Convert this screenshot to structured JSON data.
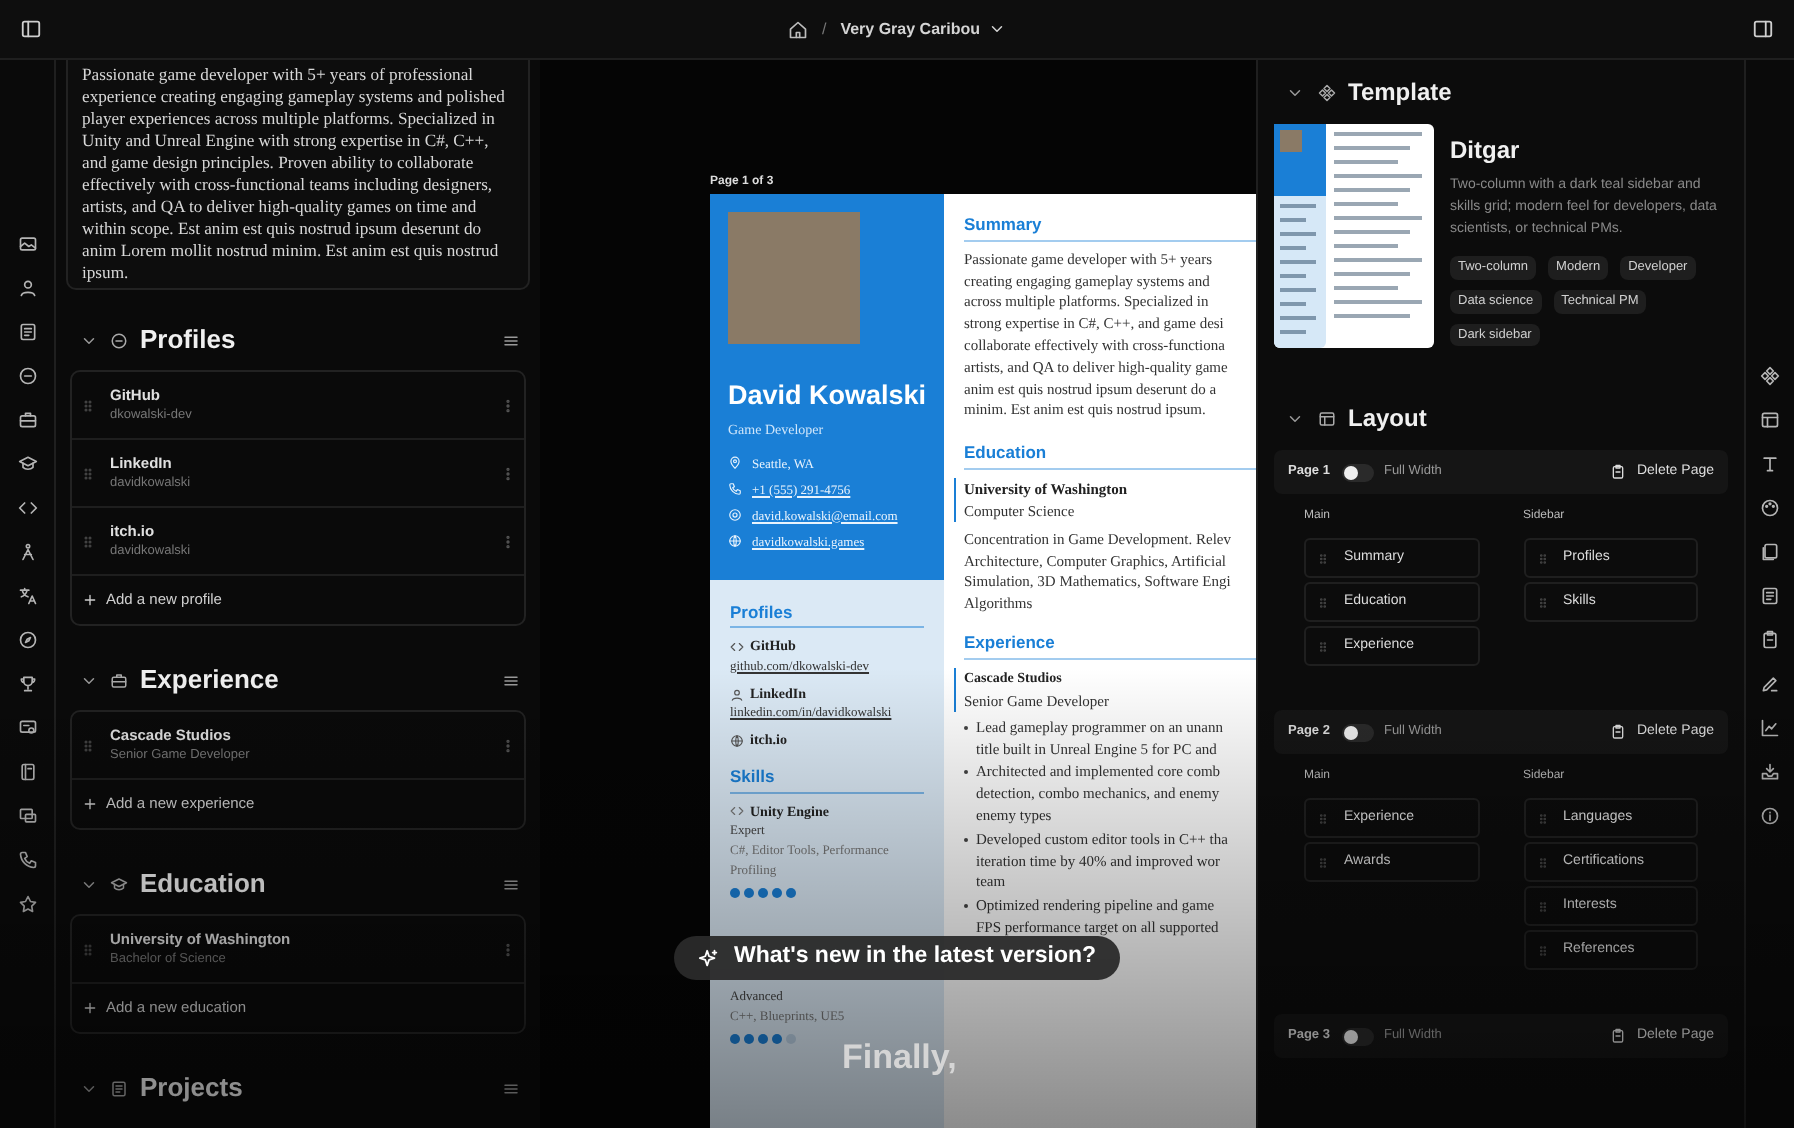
{
  "top_bar": {
    "separator": "/",
    "title": "Very Gray Caribou"
  },
  "left_panel": {
    "summary_text": "Passionate game developer with 5+ years of professional experience creating engaging gameplay systems and polished player experiences across multiple platforms. Specialized in Unity and Unreal Engine with strong expertise in C#, C++, and game design principles. Proven ability to collaborate effectively with cross-functional teams including designers, artists, and QA to deliver high-quality games on time and within scope. Est anim est quis nostrud ipsum deserunt do anim Lorem mollit nostrud minim. Est anim est quis nostrud ipsum.",
    "sections": [
      {
        "kind": "profiles",
        "title": "Profiles",
        "items": [
          {
            "title": "GitHub",
            "subtitle": "dkowalski-dev"
          },
          {
            "title": "LinkedIn",
            "subtitle": "davidkowalski"
          },
          {
            "title": "itch.io",
            "subtitle": "davidkowalski"
          }
        ],
        "add_label": "Add a new profile"
      },
      {
        "kind": "experience",
        "title": "Experience",
        "items": [
          {
            "title": "Cascade Studios",
            "subtitle": "Senior Game Developer"
          }
        ],
        "add_label": "Add a new experience"
      },
      {
        "kind": "education",
        "title": "Education",
        "items": [
          {
            "title": "University of Washington",
            "subtitle": "Bachelor of Science"
          }
        ],
        "add_label": "Add a new education"
      },
      {
        "kind": "projects",
        "title": "Projects"
      }
    ]
  },
  "resume": {
    "page_label": "Page 1 of 3",
    "name": "David Kowalski",
    "headline": "Game Developer",
    "contact": [
      {
        "kind": "location",
        "text": "Seattle, WA"
      },
      {
        "kind": "phone",
        "text": "+1 (555) 291-4756"
      },
      {
        "kind": "email",
        "text": "david.kowalski@email.com"
      },
      {
        "kind": "website",
        "text": "davidkowalski.games"
      }
    ],
    "profiles": {
      "heading": "Profiles",
      "items": [
        {
          "network": "GitHub",
          "url": "github.com/dkowalski-dev"
        },
        {
          "network": "LinkedIn",
          "url": "linkedin.com/in/davidkowalski"
        },
        {
          "network": "itch.io"
        }
      ]
    },
    "skills": {
      "heading": "Skills",
      "items": [
        {
          "name": "Unity Engine",
          "level_label": "Expert",
          "keywords": "C#, Editor Tools, Performance Profiling",
          "stars": 5
        },
        {
          "level_label": "Advanced",
          "keywords": "C++, Blueprints, UE5",
          "stars": 4
        }
      ]
    },
    "summary": {
      "heading": "Summary",
      "lines": [
        "Passionate game developer with 5+ years",
        "creating engaging gameplay systems and",
        "across multiple platforms. Specialized in",
        "strong expertise in C#, C++, and game desi",
        "collaborate effectively with cross-functiona",
        "artists, and QA to deliver high-quality game",
        "anim est quis nostrud ipsum deserunt do a",
        "minim. Est anim est quis nostrud ipsum."
      ]
    },
    "education": {
      "heading": "Education",
      "institution": "University of Washington",
      "area": "Computer Science",
      "lines": [
        "Concentration in Game Development. Relev",
        "Architecture, Computer Graphics, Artificial",
        "Simulation, 3D Mathematics, Software Engi",
        "Algorithms"
      ]
    },
    "experience": {
      "heading": "Experience",
      "company": "Cascade Studios",
      "position": "Senior Game Developer",
      "bullets": [
        [
          "Lead gameplay programmer on an unann",
          "title built in Unreal Engine 5 for PC and"
        ],
        [
          "Architected and implemented core comb",
          "detection, combo mechanics, and enemy",
          "enemy types"
        ],
        [
          "Developed custom editor tools in C++ tha",
          "iteration time by 40% and improved wor",
          "team"
        ],
        [
          "Optimized rendering pipeline and game",
          "FPS performance target on all supported"
        ]
      ]
    }
  },
  "right_panel": {
    "template": {
      "heading": "Template",
      "name": "Ditgar",
      "description": "Two-column with a dark teal sidebar and skills grid; modern feel for developers, data scientists, or technical PMs.",
      "tags": [
        "Two-column",
        "Modern",
        "Developer",
        "Data science",
        "Technical PM",
        "Dark sidebar"
      ]
    },
    "layout": {
      "heading": "Layout",
      "pages": [
        {
          "label": "Page 1",
          "full_width": false,
          "full_width_label": "Full Width",
          "delete_label": "Delete Page",
          "main_label": "Main",
          "main": [
            "Summary",
            "Education",
            "Experience"
          ],
          "sidebar_label": "Sidebar",
          "sidebar": [
            "Profiles",
            "Skills"
          ]
        },
        {
          "label": "Page 2",
          "full_width": false,
          "full_width_label": "Full Width",
          "delete_label": "Delete Page",
          "main_label": "Main",
          "main": [
            "Experience",
            "Awards"
          ],
          "sidebar_label": "Sidebar",
          "sidebar": [
            "Languages",
            "Certifications",
            "Interests",
            "References"
          ]
        },
        {
          "label": "Page 3",
          "full_width": false,
          "full_width_label": "Full Width",
          "delete_label": "Delete Page"
        }
      ]
    }
  },
  "overlay": {
    "question": "What's new in the latest version?",
    "caption": "Finally,"
  }
}
